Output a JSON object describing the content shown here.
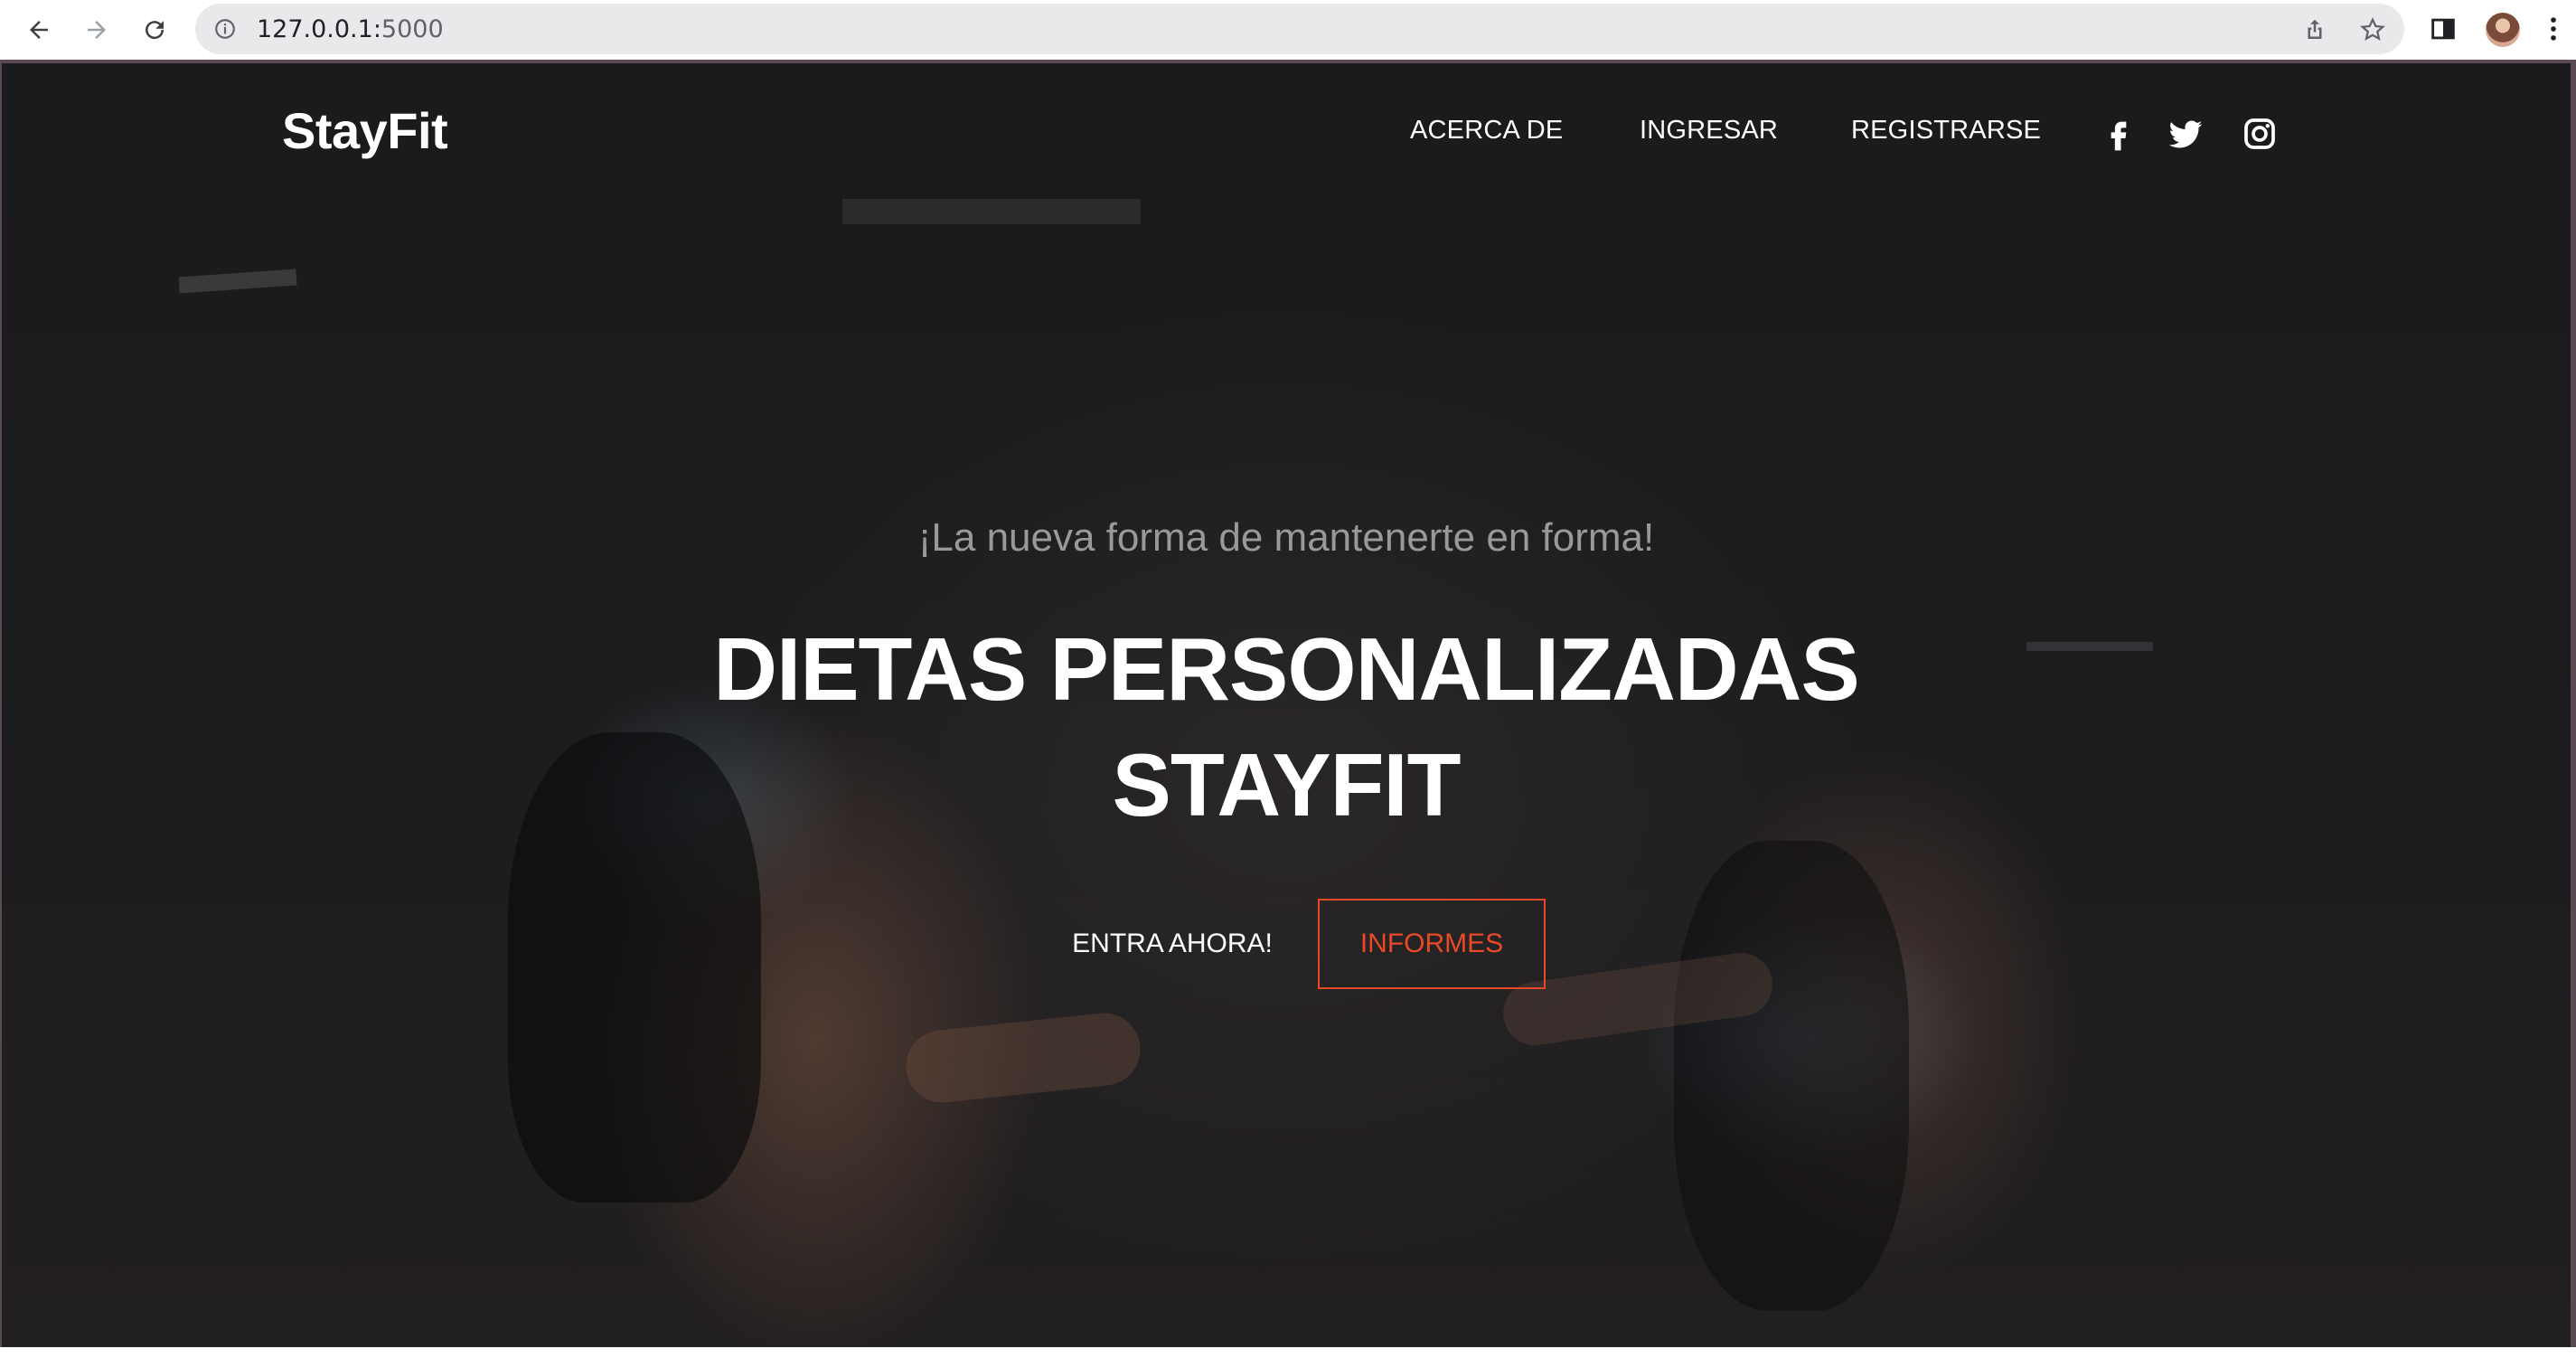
{
  "browser": {
    "url_host": "127.0.0.1:",
    "url_port": "5000",
    "icons": [
      "back-icon",
      "forward-icon",
      "reload-icon",
      "site-info-icon",
      "share-icon",
      "bookmark-star-icon",
      "side-panel-icon",
      "profile-avatar",
      "menu-dots-icon"
    ]
  },
  "navbar": {
    "brand": "StayFit",
    "links": [
      "ACERCA DE",
      "INGRESAR",
      "REGISTRARSE"
    ],
    "social": [
      "facebook-icon",
      "twitter-icon",
      "instagram-icon"
    ]
  },
  "hero": {
    "subtitle": "¡La nueva forma de mantenerte en forma!",
    "title_line1": "DIETAS PERSONALIZADAS",
    "title_line2": "STAYFIT",
    "primary_button": "ENTRA AHORA!",
    "secondary_button": "INFORMES"
  },
  "colors": {
    "accent": "#e84a27",
    "background": "#1c1b1d",
    "text": "#ffffff",
    "subtitle": "#9a9898"
  }
}
